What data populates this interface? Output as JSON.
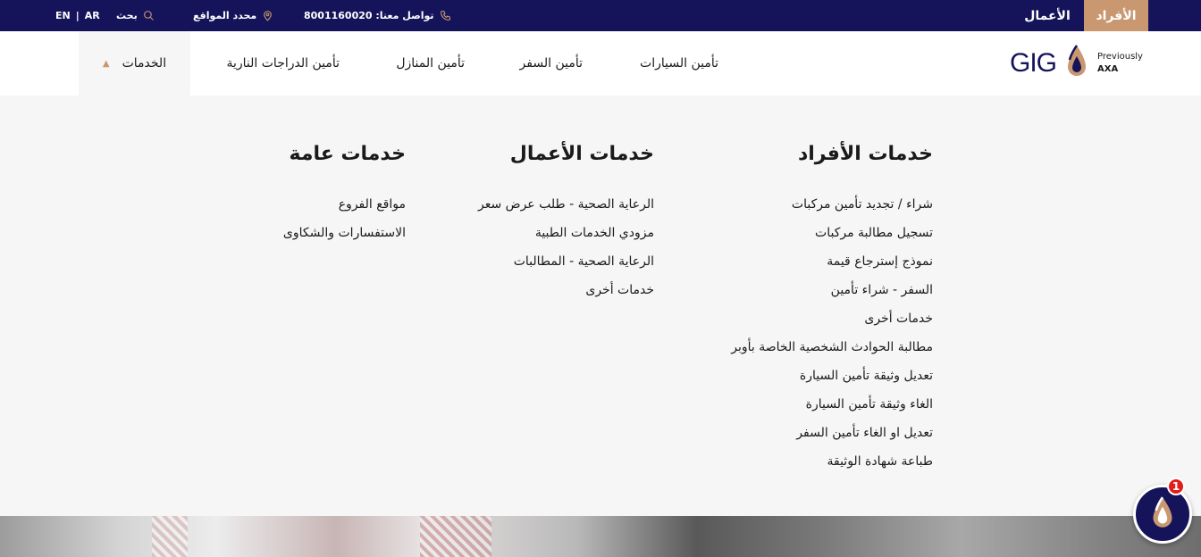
{
  "topbar": {
    "individuals": "الأفراد",
    "business": "الأعمال",
    "contact_label": "تواصل معنا: 8001160020",
    "locator_label": "محدد المواقع",
    "search_label": "بحث",
    "lang_en": "EN",
    "lang_sep": "|",
    "lang_ar": "AR"
  },
  "logo": {
    "wordmark": "GIG",
    "previously": "Previously",
    "axa": "AXA"
  },
  "nav": {
    "car": "تأمين السيارات",
    "travel": "تأمين السفر",
    "home": "تأمين المنازل",
    "motorcycle": "تأمين الدراجات النارية",
    "services": "الخدمات"
  },
  "menu": {
    "individuals": {
      "title": "خدمات الأفراد",
      "items": [
        "شراء / تجديد تأمين مركبات",
        "تسجيل مطالبة مركبات",
        "نموذج إسترجاع قيمة",
        "السفر - شراء تأمين",
        "خدمات أخرى",
        "مطالبة الحوادث الشخصية الخاصة بأوبر",
        "تعديل وثيقة تأمين السيارة",
        "الغاء وثيقة تأمين السيارة",
        "تعديل او الغاء تأمين السفر",
        "طباعة شهادة الوثيقة"
      ]
    },
    "business": {
      "title": "خدمات الأعمال",
      "items": [
        "الرعاية الصحية - طلب عرض سعر",
        "مزودي الخدمات الطبية",
        "الرعاية الصحية - المطالبات",
        "خدمات أخرى"
      ]
    },
    "general": {
      "title": "خدمات عامة",
      "items": [
        "مواقع الفروع",
        "الاستفسارات والشكاوى"
      ]
    }
  },
  "chat": {
    "badge": "1"
  },
  "colors": {
    "navy": "#15145a",
    "accent": "#c99871",
    "badge": "#e21b1b"
  }
}
